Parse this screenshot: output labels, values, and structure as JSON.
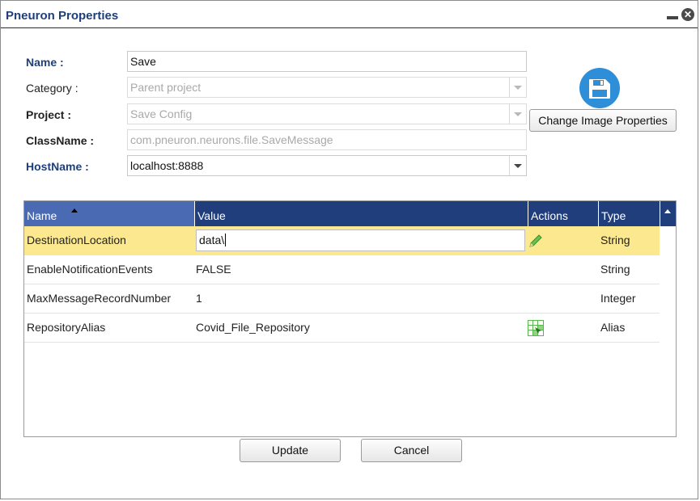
{
  "dialog": {
    "title": "Pneuron Properties",
    "minimize_icon": "minimize-icon",
    "close_icon": "close-icon"
  },
  "form": {
    "name_label": "Name :",
    "name_value": "Save",
    "category_label": "Category :",
    "category_value": "Parent project",
    "project_label": "Project :",
    "project_value": "Save Config",
    "classname_label": "ClassName :",
    "classname_value": "com.pneuron.neurons.file.SaveMessage",
    "hostname_label": "HostName :",
    "hostname_value": "localhost:8888"
  },
  "image": {
    "icon": "floppy-disk-icon",
    "accent": "#2e8fd8",
    "button_label": "Change Image Properties"
  },
  "grid": {
    "columns": [
      "Name",
      "Value",
      "Actions",
      "Type"
    ],
    "sorted_column": "Name",
    "sort_direction": "ascending",
    "rows": [
      {
        "name": "DestinationLocation",
        "value": "data\\",
        "action_icon": "pencil-icon",
        "type": "String",
        "selected": true
      },
      {
        "name": "EnableNotificationEvents",
        "value": "FALSE",
        "action_icon": "",
        "type": "String",
        "selected": false
      },
      {
        "name": "MaxMessageRecordNumber",
        "value": "1",
        "action_icon": "",
        "type": "Integer",
        "selected": false
      },
      {
        "name": "RepositoryAlias",
        "value": "Covid_File_Repository",
        "action_icon": "grid-select-icon",
        "type": "Alias",
        "selected": false
      }
    ],
    "header_color": "#203e7c",
    "selected_row_color": "#fce98f"
  },
  "buttons": {
    "update": "Update",
    "cancel": "Cancel"
  }
}
